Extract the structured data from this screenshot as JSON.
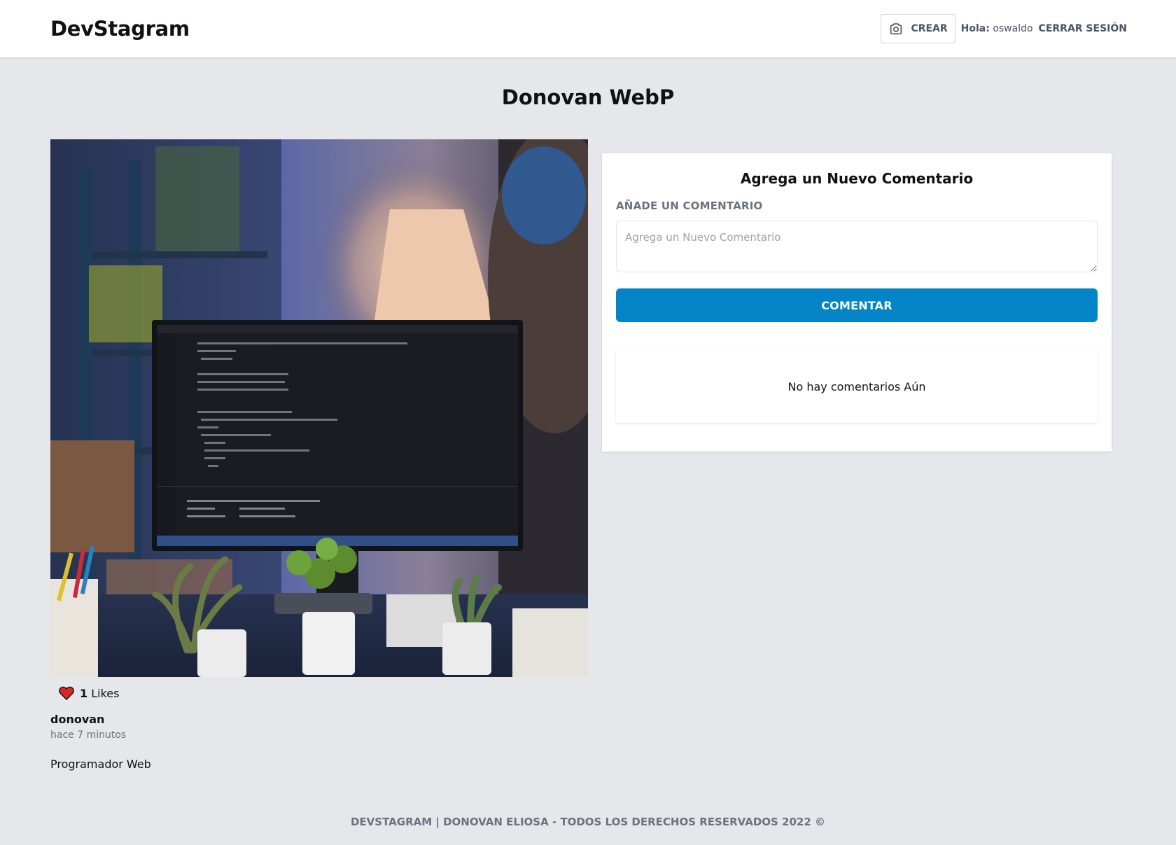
{
  "header": {
    "logo": "DevStagram",
    "create_label": "CREAR",
    "greeting_label": "Hola:",
    "username": "oswaldo",
    "logout_label": "CERRAR SESIÓN"
  },
  "page": {
    "title": "Donovan WebP"
  },
  "post": {
    "image_alt": "Programador con audífonos frente a monitor con código",
    "likes_count": "1",
    "likes_label": "Likes",
    "author": "donovan",
    "time": "hace 7 minutos",
    "description": "Programador Web"
  },
  "comments": {
    "card_title": "Agrega un Nuevo Comentario",
    "field_label": "AÑADE UN COMENTARIO",
    "placeholder": "Agrega un Nuevo Comentario",
    "submit_label": "COMENTAR",
    "empty_text": "No hay comentarios Aún"
  },
  "footer": {
    "text": "DEVSTAGRAM | DONOVAN ELIOSA - TODOS LOS DERECHOS RESERVADOS 2022 ©"
  },
  "colors": {
    "background": "#e5e7eb",
    "accent": "#0284c7",
    "heart": "#dc2626",
    "muted_text": "#6b7280"
  }
}
